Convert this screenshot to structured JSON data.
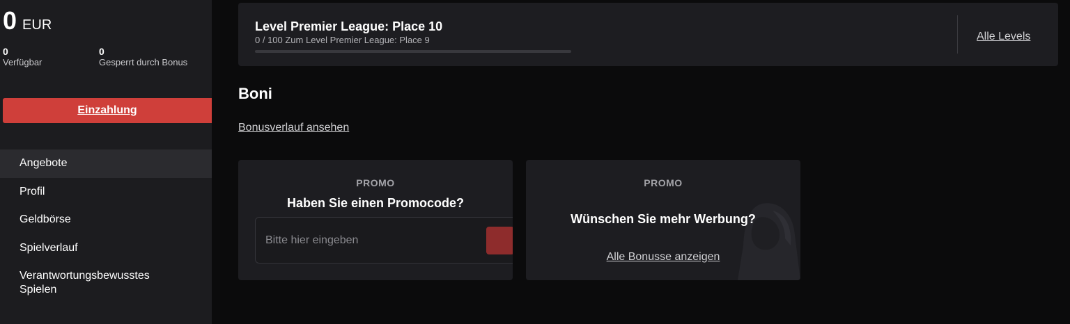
{
  "wallet": {
    "amount": "0",
    "currency": "EUR",
    "available_value": "0",
    "available_label": "Verfügbar",
    "locked_value": "0",
    "locked_label": "Gesperrt durch Bonus",
    "deposit_label": "Einzahlung"
  },
  "nav": {
    "items": [
      {
        "label": "Angebote",
        "active": true
      },
      {
        "label": "Profil"
      },
      {
        "label": "Geldbörse"
      },
      {
        "label": "Spielverlauf"
      },
      {
        "label": "Verantwortungsbewusstes Spielen"
      }
    ]
  },
  "level": {
    "title": "Level Premier League: Place 10",
    "subtitle": "0 / 100 Zum Level Premier League: Place 9",
    "progress": 0,
    "all_levels_label": "Alle Levels"
  },
  "bonuses": {
    "title": "Boni",
    "history_link": "Bonusverlauf ansehen",
    "cards": [
      {
        "eyebrow": "PROMO",
        "heading": "Haben Sie einen Promocode?",
        "input_placeholder": "Bitte hier eingeben"
      },
      {
        "eyebrow": "PROMO",
        "heading": "Wünschen Sie mehr Werbung?",
        "link": "Alle Bonusse anzeigen"
      }
    ]
  },
  "colors": {
    "accent": "#cf3f3a",
    "sidebar_bg": "#1c1c1f",
    "card_bg": "#1d1d21",
    "page_bg": "#0b0b0c"
  }
}
